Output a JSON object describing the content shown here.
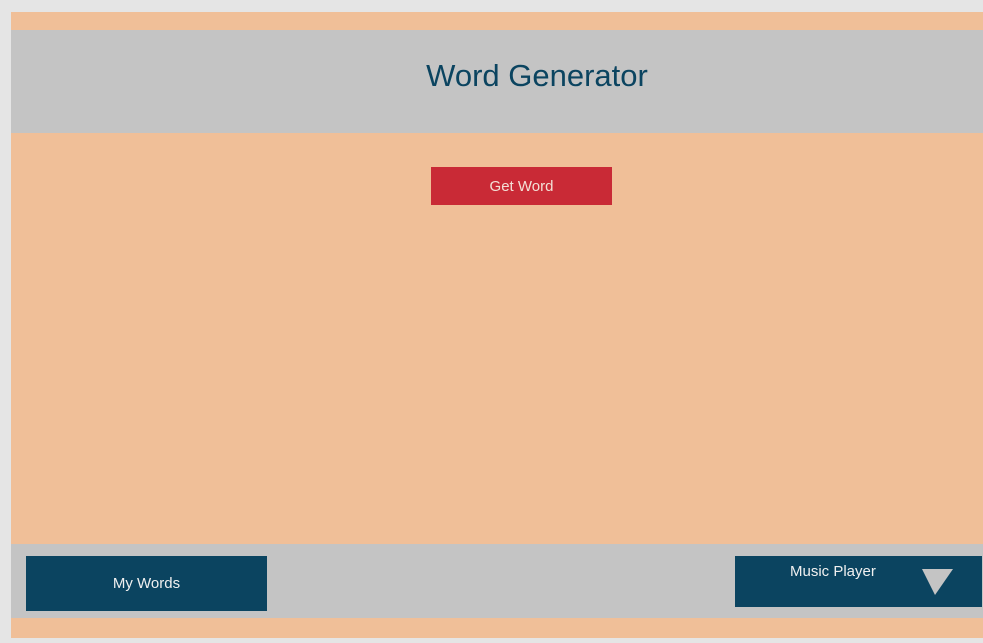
{
  "header": {
    "title": "Word Generator"
  },
  "main": {
    "get_word_label": "Get Word"
  },
  "footer": {
    "my_words_label": "My Words",
    "music_player_label": "Music Player",
    "music_player_icon": "play-icon"
  },
  "colors": {
    "background": "#f0bf98",
    "bar": "#c4c4c4",
    "title_text": "#0b4460",
    "primary_button": "#c92a36",
    "nav_button": "#0b4460"
  }
}
